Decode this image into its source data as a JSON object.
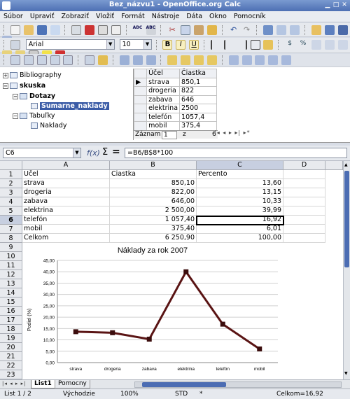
{
  "window": {
    "title": "Bez_názvu1 - OpenOffice.org Calc"
  },
  "menu": [
    "Súbor",
    "Upraviť",
    "Zobraziť",
    "Vložiť",
    "Formát",
    "Nástroje",
    "Dáta",
    "Okno",
    "Pomocník"
  ],
  "format_toolbar": {
    "font_name": "Arial",
    "font_size": "10"
  },
  "navigator": {
    "tree": {
      "bibliography": "Bibliography",
      "database": "skuska",
      "queries": "Dotazy",
      "query_item": "Sumarne_naklady",
      "tables": "Tabuľky",
      "table_item": "Naklady"
    },
    "grid_headers": [
      "Účel",
      "Čiastka"
    ],
    "grid_rows": [
      [
        "strava",
        "850,1"
      ],
      [
        "drogeria",
        "822"
      ],
      [
        "zabava",
        "646"
      ],
      [
        "elektrina",
        "2500"
      ],
      [
        "telefón",
        "1057,4"
      ],
      [
        "mobil",
        "375,4"
      ]
    ],
    "record_label": "Záznam",
    "record_current": "1",
    "record_of": "z",
    "record_total": "6"
  },
  "formula_bar": {
    "cell_ref": "C6",
    "formula": "=B6/B$8*100"
  },
  "sheet": {
    "columns": [
      "A",
      "B",
      "C",
      "D"
    ],
    "rows": [
      "1",
      "2",
      "3",
      "4",
      "5",
      "6",
      "7",
      "8",
      "9",
      "10",
      "11",
      "12",
      "13",
      "14",
      "15",
      "16",
      "17",
      "18",
      "19",
      "20",
      "21",
      "22",
      "23"
    ],
    "cells": [
      [
        "Účel",
        "Čiastka",
        "Percento"
      ],
      [
        "strava",
        "850,10",
        "13,60"
      ],
      [
        "drogeria",
        "822,00",
        "13,15"
      ],
      [
        "zabava",
        "646,00",
        "10,33"
      ],
      [
        "elektrina",
        "2 500,00",
        "39,99"
      ],
      [
        "telefón",
        "1 057,40",
        "16,92"
      ],
      [
        "mobil",
        "375,40",
        "6,01"
      ],
      [
        "Celkom",
        "6 250,90",
        "100,00"
      ]
    ]
  },
  "chart_data": {
    "type": "line",
    "title": "Náklady za rok 2007",
    "ylabel": "Podiel (%)",
    "xlabel": "",
    "categories": [
      "strava",
      "drogeria",
      "zabava",
      "elektrina",
      "telefón",
      "mobil"
    ],
    "values": [
      13.6,
      13.15,
      10.33,
      39.99,
      16.92,
      6.01
    ],
    "ylim": [
      0,
      45
    ],
    "yticks": [
      "0,00",
      "5,00",
      "10,00",
      "15,00",
      "20,00",
      "25,00",
      "30,00",
      "35,00",
      "40,00",
      "45,00"
    ],
    "grid": true,
    "line_color": "#5a1414"
  },
  "sheet_tabs": [
    "List1",
    "Pomocny"
  ],
  "status": {
    "sheet": "List 1 / 2",
    "style": "Východzie",
    "zoom": "100%",
    "mode": "STD",
    "modified": "*",
    "sum": "Celkom=16,92"
  }
}
